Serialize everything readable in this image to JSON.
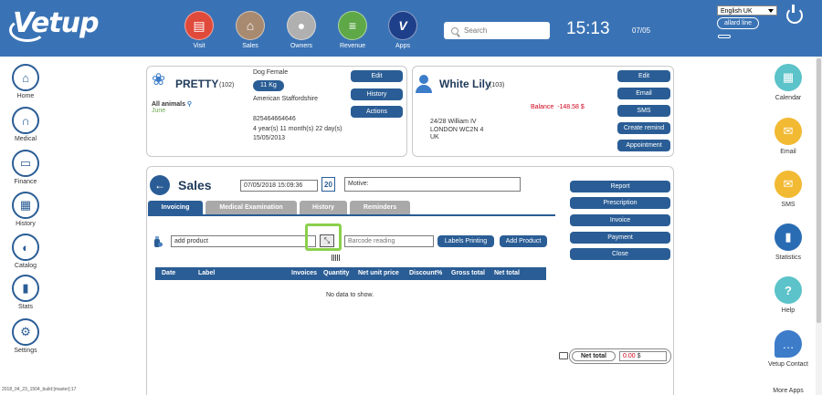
{
  "header": {
    "logo": "Vetup",
    "nav": [
      {
        "label": "Visit",
        "icon": "clipboard-icon",
        "color": "#e04a3b"
      },
      {
        "label": "Sales",
        "icon": "shop-icon",
        "color": "#a88a70"
      },
      {
        "label": "Owners",
        "icon": "person-icon",
        "color": "#b0b0b0"
      },
      {
        "label": "Revenue",
        "icon": "coins-icon",
        "color": "#5ea848"
      },
      {
        "label": "Apps",
        "icon": "apps-v-icon",
        "color": "#1e3f8a"
      }
    ],
    "search_placeholder": "Search",
    "time": "15:13",
    "date": "07/05",
    "language": "English UK",
    "user": "allard line"
  },
  "left_nav": [
    {
      "label": "Home",
      "icon": "house-icon"
    },
    {
      "label": "Medical",
      "icon": "stethoscope-icon"
    },
    {
      "label": "Finance",
      "icon": "cash-icon"
    },
    {
      "label": "History",
      "icon": "calendar-icon"
    },
    {
      "label": "Catalog",
      "icon": "catalog-icon"
    },
    {
      "label": "Stats",
      "icon": "stats-icon"
    },
    {
      "label": "Settings",
      "icon": "gears-icon"
    }
  ],
  "build": "2018_04_23_1504_build:[master]:17",
  "right_nav": [
    {
      "label": "Calendar",
      "icon": "calendar-icon",
      "color": "#5bc3c9"
    },
    {
      "label": "Email",
      "icon": "envelope-icon",
      "color": "#f2b933"
    },
    {
      "label": "SMS",
      "icon": "envelope-icon",
      "color": "#f2b933"
    },
    {
      "label": "Statistics",
      "icon": "bar-chart-icon",
      "color": "#2a6cb3"
    },
    {
      "label": "Help",
      "icon": "question-icon",
      "color": "#5bc3c9"
    },
    {
      "label": "Vetup Contact",
      "icon": "chat-bubbles-icon",
      "color": "#3d7cc9"
    },
    {
      "label": "More Apps",
      "icon": "",
      "color": ""
    }
  ],
  "animal": {
    "name": "PRETTY",
    "id": "(102)",
    "species": "Dog Female",
    "weight": "11 Kg",
    "breed": "American Staffordshire",
    "group": "All animals",
    "birth_month": "June",
    "chip": "825464664646",
    "age": "4 year(s) 11 month(s) 22 day(s)",
    "dob": "15/05/2013",
    "buttons": [
      "Edit",
      "History",
      "Actions"
    ]
  },
  "owner": {
    "name": "White Lily",
    "id": "(103)",
    "balance_label": "Balance",
    "balance_value": "-148.58 $",
    "address1": "24/28 William IV",
    "address2": "LONDON WC2N 4",
    "country": "UK",
    "buttons": [
      "Edit",
      "Email",
      "SMS",
      "Create remind",
      "Appointment"
    ]
  },
  "sales": {
    "title": "Sales",
    "date": "07/05/2018 15:09:36",
    "calendar_day": "20",
    "motive_placeholder": "Motive:",
    "tabs": [
      "Invoicing",
      "Medical Examination",
      "History",
      "Reminders"
    ],
    "add_product_placeholder": "add product",
    "barcode_placeholder": "Barcode reading",
    "labels_printing": "Labels Printing",
    "add_product_button": "Add Product",
    "actions": [
      "Report",
      "Prescription",
      "Invoice",
      "Payment",
      "Close"
    ],
    "columns": [
      "Date",
      "Label",
      "Invoices",
      "Quantity",
      "Net unit price",
      "Discount%",
      "Gross total",
      "Net total"
    ],
    "empty_message": "No data to show.",
    "net_total_label": "Net total",
    "net_total_value": "0.00",
    "currency": "$"
  }
}
